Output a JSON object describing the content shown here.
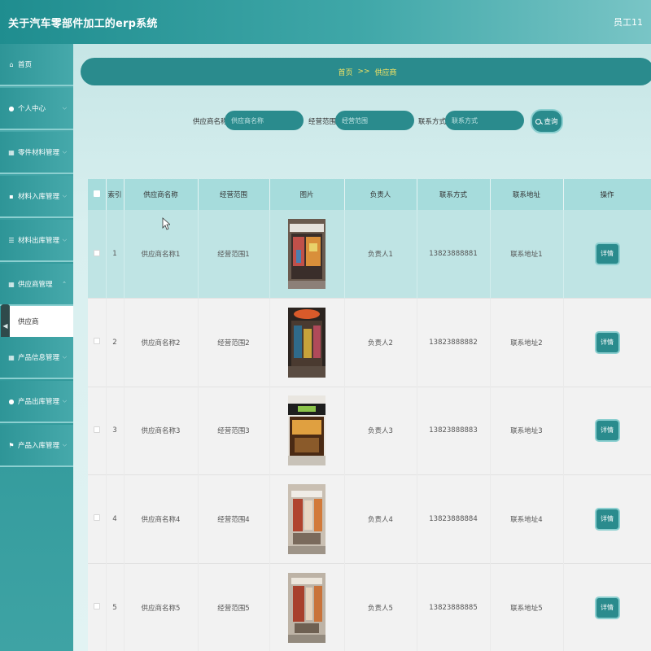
{
  "header": {
    "title": "关于汽车零部件加工的erp系统",
    "user": "员工11"
  },
  "sidebar": {
    "items": [
      {
        "label": "首页",
        "icon": "home-icon",
        "glyph": "⌂",
        "has_chevron": false
      },
      {
        "label": "个人中心",
        "icon": "user-icon",
        "glyph": "●",
        "has_chevron": true
      },
      {
        "label": "零件材料管理",
        "icon": "grid-icon",
        "glyph": "▦",
        "has_chevron": true
      },
      {
        "label": "材料入库管理",
        "icon": "bag-icon",
        "glyph": "▪",
        "has_chevron": true
      },
      {
        "label": "材料出库管理",
        "icon": "list-icon",
        "glyph": "☰",
        "has_chevron": true
      },
      {
        "label": "供应商管理",
        "icon": "grid-icon",
        "glyph": "▦",
        "has_chevron": true
      },
      {
        "label": "产品信息管理",
        "icon": "grid-icon",
        "glyph": "▦",
        "has_chevron": true
      },
      {
        "label": "产品出库管理",
        "icon": "user-icon",
        "glyph": "●",
        "has_chevron": true
      },
      {
        "label": "产品入库管理",
        "icon": "flag-icon",
        "glyph": "⚑",
        "has_chevron": true
      }
    ],
    "submenu": {
      "label": "供应商"
    },
    "collapse_glyph": "◀"
  },
  "breadcrumb": {
    "home": "首页",
    "separator": ">>",
    "current": "供应商"
  },
  "search": {
    "name_label": "供应商名称",
    "name_placeholder": "供应商名称",
    "scope_label": "经营范围",
    "scope_placeholder": "经营范围",
    "contact_label": "联系方式",
    "contact_placeholder": "联系方式",
    "button_label": "查询"
  },
  "table": {
    "columns": [
      "索引",
      "供应商名称",
      "经营范围",
      "图片",
      "负责人",
      "联系方式",
      "联系地址",
      "操作"
    ],
    "action_label": "详情",
    "rows": [
      {
        "index": "1",
        "name": "供应商名称1",
        "scope": "经营范围1",
        "manager": "负责人1",
        "phone": "13823888881",
        "address": "联系地址1"
      },
      {
        "index": "2",
        "name": "供应商名称2",
        "scope": "经营范围2",
        "manager": "负责人2",
        "phone": "13823888882",
        "address": "联系地址2"
      },
      {
        "index": "3",
        "name": "供应商名称3",
        "scope": "经营范围3",
        "manager": "负责人3",
        "phone": "13823888883",
        "address": "联系地址3"
      },
      {
        "index": "4",
        "name": "供应商名称4",
        "scope": "经营范围4",
        "manager": "负责人4",
        "phone": "13823888884",
        "address": "联系地址4"
      },
      {
        "index": "5",
        "name": "供应商名称5",
        "scope": "经营范围5",
        "manager": "负责人5",
        "phone": "13823888885",
        "address": "联系地址5"
      }
    ]
  },
  "colors": {
    "accent": "#2a8b8d",
    "breadcrumb_text": "#f5e463",
    "header_start": "#1f8d8f"
  }
}
